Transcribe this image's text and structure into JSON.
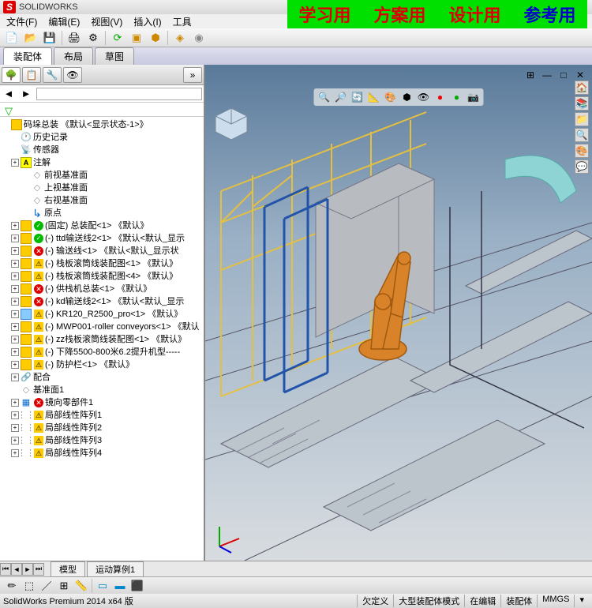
{
  "banner": {
    "b1": "学习用",
    "b2": "方案用",
    "b3": "设计用",
    "b4": "参考用"
  },
  "menu": {
    "file": "文件(F)",
    "edit": "编辑(E)",
    "view": "视图(V)",
    "insert": "插入(I)",
    "tools": "工具"
  },
  "ribbon": {
    "t1": "装配体",
    "t2": "布局",
    "t3": "草图"
  },
  "tree": {
    "root": "码垛总装    《默认<显示状态-1>》",
    "history": "历史记录",
    "sensor": "传感器",
    "annot": "注解",
    "plane1": "前视基准面",
    "plane2": "上视基准面",
    "plane3": "右视基准面",
    "origin": "原点",
    "i1": "(固定) 总装配<1> 《默认》",
    "i2": "(-) ttd输送线2<1> 《默认<默认_显示",
    "i3": "(-) 输送线<1> 《默认<默认_显示状",
    "i4": "(-) 栈板滚筒线装配图<1> 《默认》",
    "i5": "(-) 栈板滚筒线装配图<4> 《默认》",
    "i6": "(-) 供栈机总装<1> 《默认》",
    "i7": "(-) kd输送线2<1> 《默认<默认_显示",
    "i8": "(-) KR120_R2500_pro<1> 《默认》",
    "i9": "(-) MWP001-roller conveyors<1> 《默认",
    "i10": "(-) zz栈板滚筒线装配图<1> 《默认》",
    "i11": "(-) 下降5500-800米6.2提升机型-----",
    "i12": "(-) 防护栏<1> 《默认》",
    "mates": "配合",
    "plane": "基准面1",
    "mir": "镜向零部件1",
    "pat1": "局部线性阵列1",
    "pat2": "局部线性阵列2",
    "pat3": "局部线性阵列3",
    "pat4": "局部线性阵列4"
  },
  "bottomtabs": {
    "t1": "模型",
    "t2": "运动算例1"
  },
  "status": {
    "version": "SolidWorks Premium 2014 x64 版",
    "c1": "欠定义",
    "c2": "大型装配体模式",
    "c3": "在编辑",
    "c4": "装配体",
    "c5": "MMGS"
  }
}
